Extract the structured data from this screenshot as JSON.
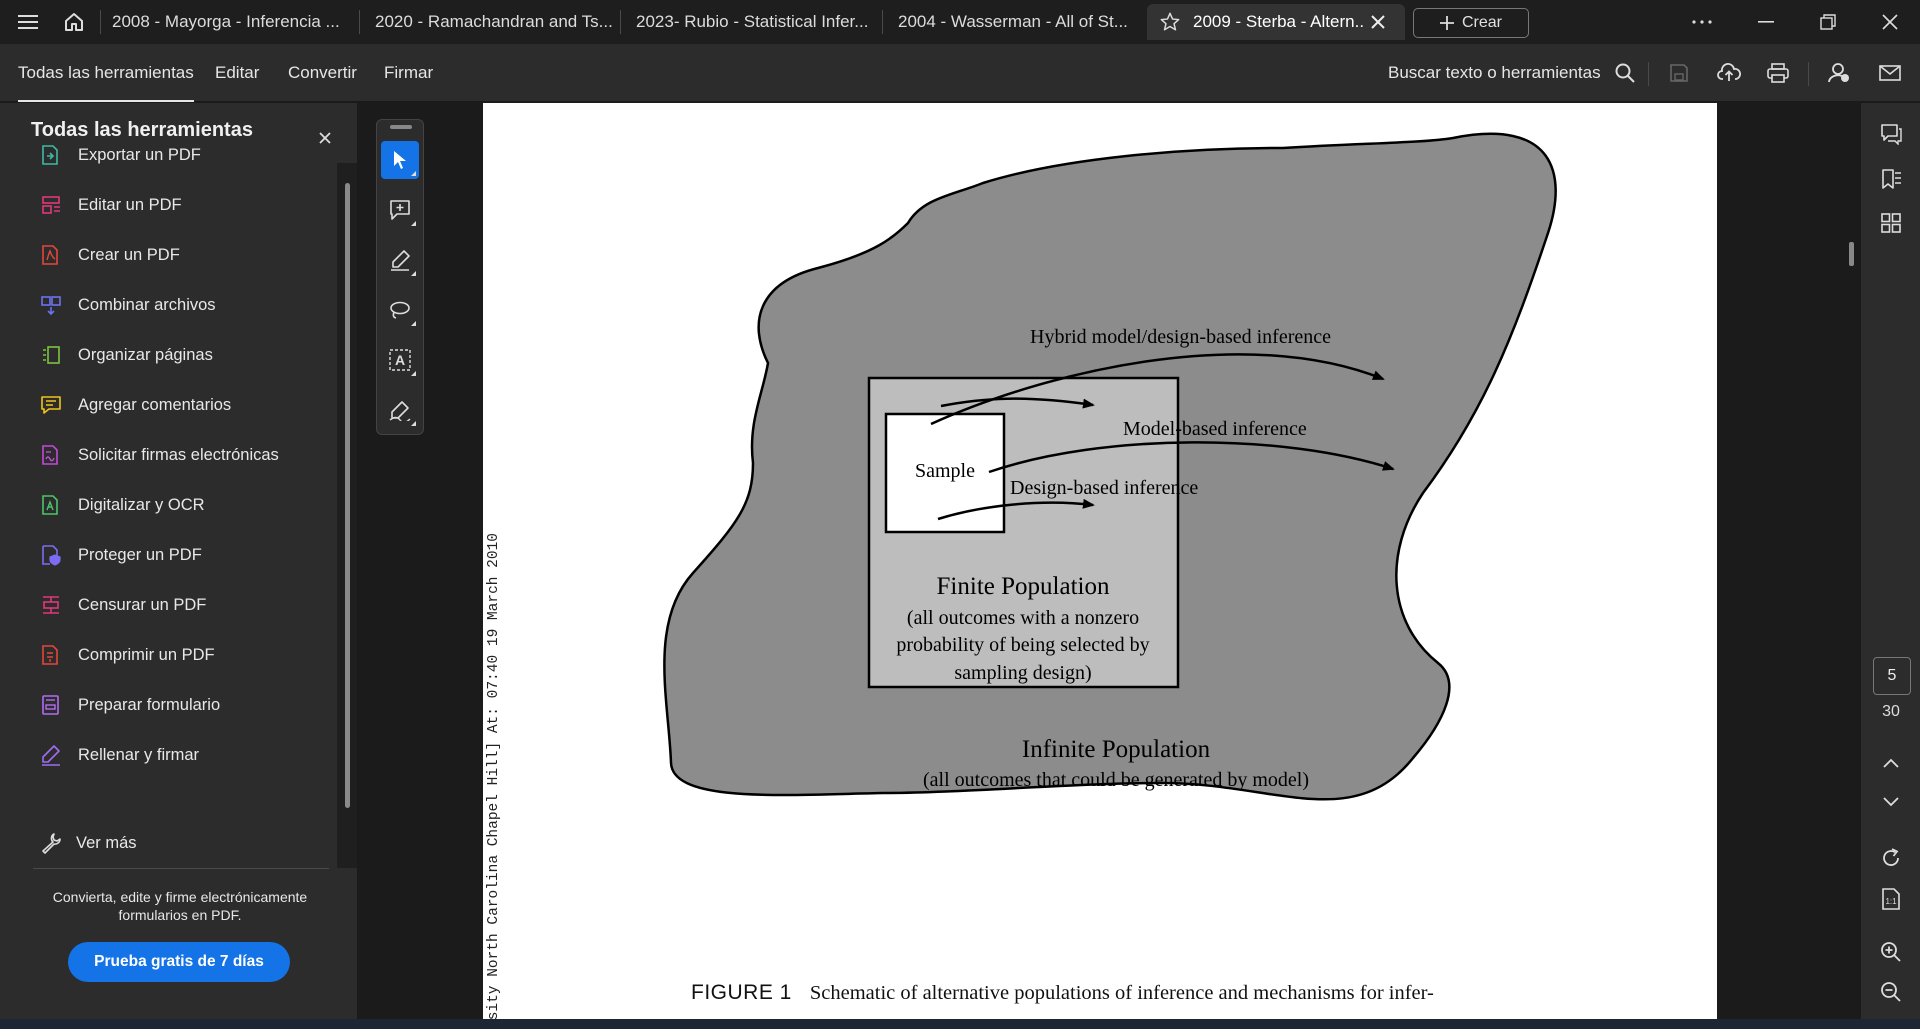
{
  "tabs": [
    {
      "label": "2008 - Mayorga - Inferencia ...",
      "active": false
    },
    {
      "label": "2020 - Ramachandran and Ts...",
      "active": false
    },
    {
      "label": "2023- Rubio - Statistical Infer...",
      "active": false
    },
    {
      "label": "2004 - Wasserman - All of St...",
      "active": false
    },
    {
      "label": "2009 - Sterba - Altern...",
      "active": true
    }
  ],
  "tabbar": {
    "create_label": "Crear"
  },
  "menu": {
    "items": [
      "Todas las herramientas",
      "Editar",
      "Convertir",
      "Firmar"
    ],
    "search_label": "Buscar texto o herramientas"
  },
  "tools_panel": {
    "title": "Todas las herramientas",
    "items": [
      {
        "label": "Exportar un PDF",
        "icon": "export-pdf-icon",
        "color": "#3fb9a3"
      },
      {
        "label": "Editar un PDF",
        "icon": "edit-pdf-icon",
        "color": "#e0387a"
      },
      {
        "label": "Crear un PDF",
        "icon": "create-pdf-icon",
        "color": "#e3473b"
      },
      {
        "label": "Combinar archivos",
        "icon": "combine-files-icon",
        "color": "#6b72f0"
      },
      {
        "label": "Organizar páginas",
        "icon": "organize-pages-icon",
        "color": "#7cc242"
      },
      {
        "label": "Agregar comentarios",
        "icon": "add-comment-icon",
        "color": "#f0c419"
      },
      {
        "label": "Solicitar firmas electrónicas",
        "icon": "request-signature-icon",
        "color": "#c24ad6"
      },
      {
        "label": "Digitalizar y OCR",
        "icon": "scan-ocr-icon",
        "color": "#4cc36a"
      },
      {
        "label": "Proteger un PDF",
        "icon": "protect-pdf-icon",
        "color": "#7b6cf2"
      },
      {
        "label": "Censurar un PDF",
        "icon": "redact-pdf-icon",
        "color": "#e0387a"
      },
      {
        "label": "Comprimir un PDF",
        "icon": "compress-pdf-icon",
        "color": "#e3473b"
      },
      {
        "label": "Preparar formulario",
        "icon": "prepare-form-icon",
        "color": "#b26cf2"
      },
      {
        "label": "Rellenar y firmar",
        "icon": "fill-sign-icon",
        "color": "#a06cf2"
      }
    ],
    "more_label": "Ver más",
    "promo_text": "Convierta, edite y firme electrónicamente formularios en PDF.",
    "trial_button": "Prueba gratis de 7 días"
  },
  "document": {
    "margin_stamp": "rsity North Carolina Chapel Hill] At: 07:40 19 March 2010",
    "figure": {
      "hybrid_label": "Hybrid model/design-based inference",
      "model_label": "Model-based inference",
      "design_label": "Design-based inference",
      "sample_label": "Sample",
      "finite_title": "Finite Population",
      "finite_desc": [
        "(all outcomes with a nonzero",
        "probability of being selected by",
        "sampling design)"
      ],
      "infinite_title": "Infinite Population",
      "infinite_desc": "(all outcomes that could be generated by model)"
    },
    "caption_label": "FIGURE 1",
    "caption_text": "Schematic of alternative populations of inference and mechanisms for infer-"
  },
  "page_nav": {
    "current": "5",
    "total": "30"
  },
  "colors": {
    "accent": "#1473e6",
    "outer_blob": "#8c8c8c",
    "inner_rect": "#bdbdbd"
  }
}
